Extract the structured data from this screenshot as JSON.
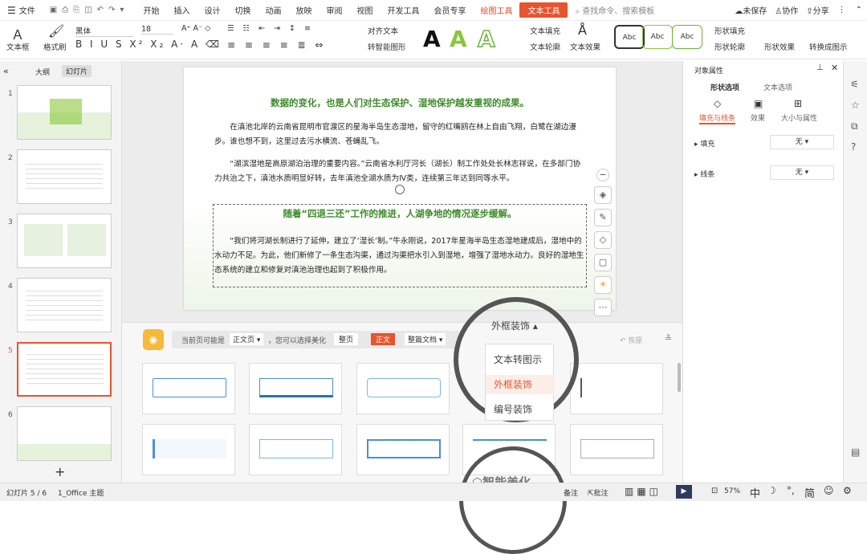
{
  "menubar": {
    "file": "文件",
    "items": [
      "开始",
      "插入",
      "设计",
      "切换",
      "动画",
      "放映",
      "审阅",
      "视图",
      "开发工具",
      "会员专享"
    ],
    "context_tab": "绘图工具",
    "active_tab": "文本工具",
    "search": "查找命令、搜索模板",
    "unsaved": "未保存",
    "collab": "协作",
    "share": "分享"
  },
  "ribbon": {
    "textbox": "文本框",
    "format_painter": "格式刷",
    "font": "黑体",
    "size": "18",
    "align_text": "对齐文本",
    "smart_shape": "转智能图形",
    "text_fill": "文本填充",
    "text_outline": "文本轮廓",
    "text_effect": "文本效果",
    "abc": [
      "Abc",
      "Abc",
      "Abc"
    ],
    "shape_fill": "形状填充",
    "shape_outline": "形状轮廓",
    "shape_effect": "形状效果",
    "to_image": "转换成图示"
  },
  "leftpanel": {
    "tab_outline": "大纲",
    "tab_slides": "幻灯片",
    "numbers": [
      "1",
      "2",
      "3",
      "4",
      "5",
      "6"
    ],
    "add": "+"
  },
  "slide": {
    "title1": "数据的变化，也是人们对生态保护、湿地保护越发重视的成果。",
    "para1": "在滇池北岸的云南省昆明市官渡区的星海半岛生态湿地，留守的红嘴鸥在林上自由飞翔，白鹭在湖边漫步。谁也想不到，这里过去污水横流、苍蝇乱飞。",
    "para2": "“湖滨湿地是高原湖泊治理的重要内容。”云南省水利厅河长（湖长）制工作处处长林志祥说，在多部门协力共治之下，滇池水质明显好转，去年滇池全湖水质为Ⅳ类，连续第三年达到同等水平。",
    "title2": "随着“四退三还”工作的推进，人湖争地的情况逐步缓解。",
    "para3": "“我们将河湖长制进行了延伸，建立了‘湿长’制。”牛永刚说，2017年星海半岛生态湿地建成后，湿地中的水动力不足。为此，他们新修了一条生态沟渠，通过沟渠把水引入到湿地，增强了湿地水动力。良好的湿地生态系统的建立和修复对滇池治理也起到了积极作用。"
  },
  "beautify": {
    "current_page": "当前页可能是",
    "page_type": "正文页",
    "hint": "，您可以选择美化",
    "whole_page": "整页",
    "body": "正文",
    "whole_doc": "整篇文档",
    "dropdown": "外框装饰",
    "options": [
      "文本转图示",
      "外框装饰",
      "编号装饰"
    ],
    "restore": "恢原",
    "smart": "智能美化"
  },
  "rightpanel": {
    "title": "对象属性",
    "tab_shape": "形状选项",
    "tab_text": "文本选项",
    "sub_fill": "填充与线条",
    "sub_effect": "效果",
    "sub_size": "大小与属性",
    "fill_label": "填充",
    "fill_value": "无",
    "line_label": "线条",
    "line_value": "无"
  },
  "statusbar": {
    "slide_count": "幻灯片 5 / 6",
    "theme": "1_Office 主题",
    "notes": "备注",
    "comments": "批注",
    "zoom": "57%",
    "ime": "中",
    "simplified": "简"
  },
  "colors": {
    "accent": "#e8542e",
    "green": "#3f8a2c"
  }
}
